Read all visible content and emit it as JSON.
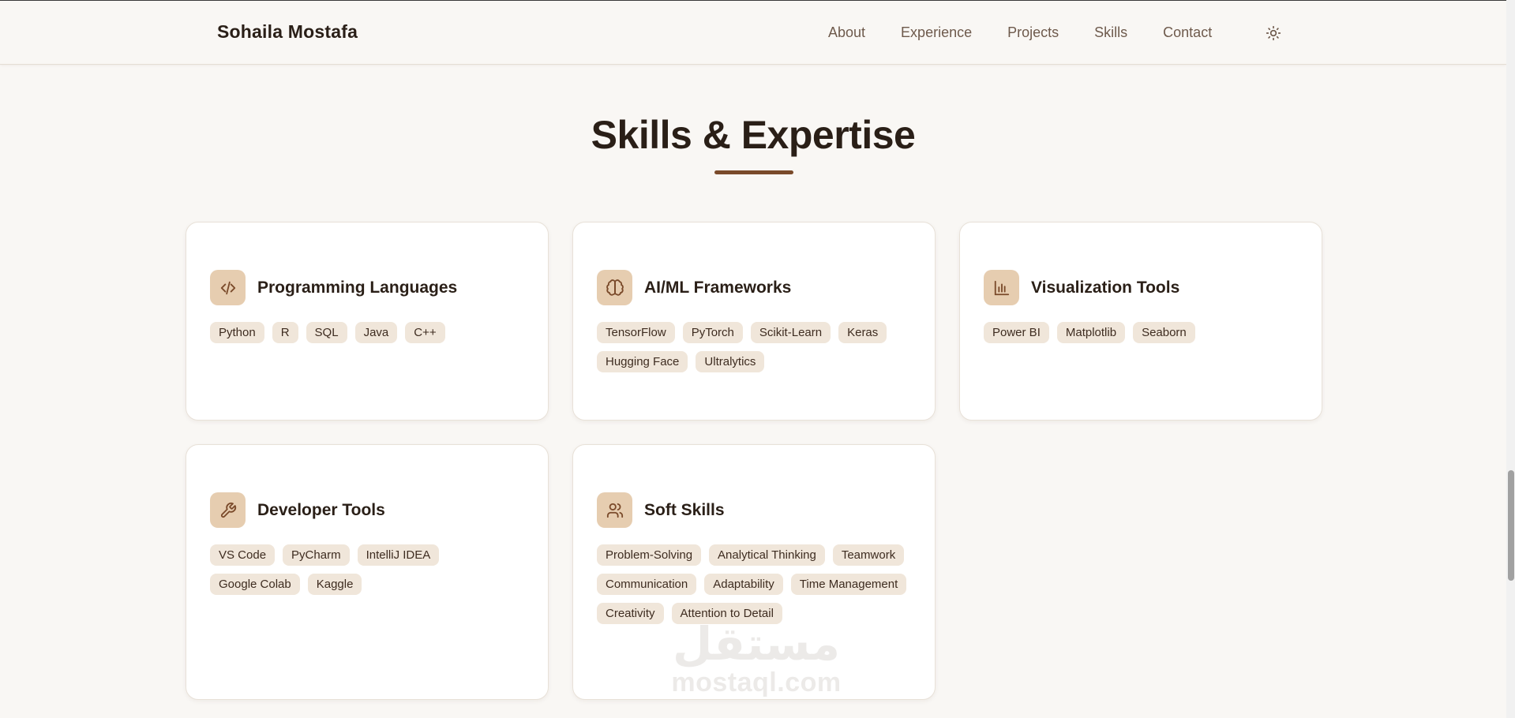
{
  "header": {
    "brand": "Sohaila Mostafa",
    "nav": [
      "About",
      "Experience",
      "Projects",
      "Skills",
      "Contact"
    ],
    "theme_icon": "sun-icon"
  },
  "section": {
    "title": "Skills & Expertise",
    "underline_color": "#7a4a2a"
  },
  "colors": {
    "background": "#f9f7f4",
    "card": "#ffffff",
    "icon_tile": "#e6cdb0",
    "tag": "#f0e6da",
    "text": "#2a1f17",
    "accent": "#7a4a2a"
  },
  "cards": [
    {
      "icon": "code-icon",
      "title": "Programming Languages",
      "tags": [
        "Python",
        "R",
        "SQL",
        "Java",
        "C++"
      ]
    },
    {
      "icon": "brain-icon",
      "title": "AI/ML Frameworks",
      "tags": [
        "TensorFlow",
        "PyTorch",
        "Scikit-Learn",
        "Keras",
        "Hugging Face",
        "Ultralytics"
      ]
    },
    {
      "icon": "bar-chart-icon",
      "title": "Visualization Tools",
      "tags": [
        "Power BI",
        "Matplotlib",
        "Seaborn"
      ]
    },
    {
      "icon": "wrench-icon",
      "title": "Developer Tools",
      "tags": [
        "VS Code",
        "PyCharm",
        "IntelliJ IDEA",
        "Google Colab",
        "Kaggle"
      ]
    },
    {
      "icon": "users-icon",
      "title": "Soft Skills",
      "tags": [
        "Problem-Solving",
        "Analytical Thinking",
        "Teamwork",
        "Communication",
        "Adaptability",
        "Time Management",
        "Creativity",
        "Attention to Detail"
      ]
    }
  ],
  "watermark": {
    "arabic": "مستقل",
    "latin": "mostaql.com"
  }
}
